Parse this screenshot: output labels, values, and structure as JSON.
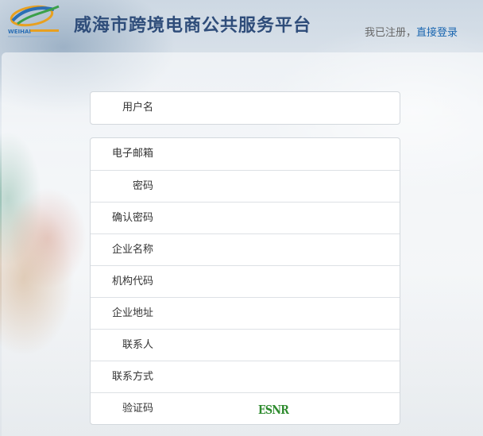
{
  "header": {
    "logo_icon": "weihai-logo-icon",
    "logo_text": "WEIHAI",
    "site_title": "威海市跨境电商公共服务平台",
    "registered_prompt": "我已注册，",
    "login_link": "直接登录"
  },
  "form": {
    "username_label": "用户名",
    "fields": [
      {
        "label": "电子邮箱",
        "value": ""
      },
      {
        "label": "密码",
        "value": ""
      },
      {
        "label": "确认密码",
        "value": ""
      },
      {
        "label": "企业名称",
        "value": ""
      },
      {
        "label": "机构代码",
        "value": ""
      },
      {
        "label": "企业地址",
        "value": ""
      },
      {
        "label": "联系人",
        "value": ""
      },
      {
        "label": "联系方式",
        "value": ""
      },
      {
        "label": "验证码",
        "value": ""
      }
    ],
    "captcha_text": "ESNR",
    "captcha_color": "#2e8b2e"
  },
  "colors": {
    "title": "#2f4d7a",
    "link": "#1a66b0"
  }
}
